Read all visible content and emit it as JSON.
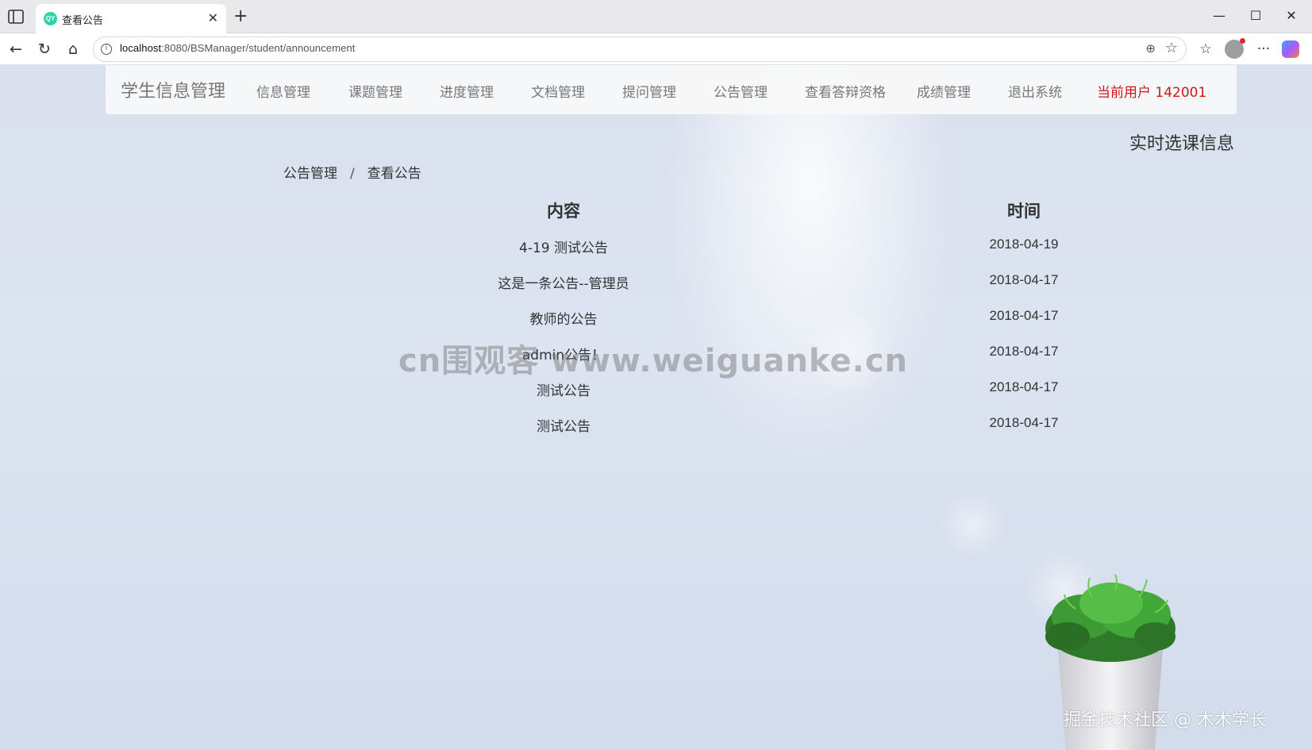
{
  "browser": {
    "tab_title": "查看公告",
    "tab_favicon_text": "QY",
    "tab_close": "✕",
    "new_tab": "+",
    "url_host": "localhost",
    "url_path": ":8080/BSManager/student/announcement",
    "window_controls": {
      "minimize": "—",
      "maximize": "☐",
      "close": "✕"
    },
    "icons": {
      "back": "←",
      "reload": "↻",
      "home": "⌂",
      "info": "i",
      "zoom": "⊕",
      "star": "☆",
      "favorites": "☆",
      "more": "···"
    }
  },
  "navbar": {
    "brand": "学生信息管理",
    "items": [
      {
        "label": "信息管理"
      },
      {
        "label": "课题管理"
      },
      {
        "label": "进度管理"
      },
      {
        "label": "文档管理"
      },
      {
        "label": "提问管理"
      },
      {
        "label": "公告管理"
      },
      {
        "label": "查看答辩资格"
      },
      {
        "label": "成绩管理"
      },
      {
        "label": "退出系统"
      }
    ],
    "current_user": "当前用户  142001",
    "current_user_color": "#d0161c"
  },
  "sidebar_link": "实时选课信息",
  "breadcrumb": {
    "parent": "公告管理",
    "separator": "/",
    "current": "查看公告"
  },
  "table": {
    "headers": {
      "content": "内容",
      "time": "时间"
    },
    "rows": [
      {
        "content": "4-19 测试公告",
        "time": "2018-04-19"
      },
      {
        "content": "这是一条公告--管理员",
        "time": "2018-04-17"
      },
      {
        "content": "教师的公告",
        "time": "2018-04-17"
      },
      {
        "content": "admin公告！",
        "time": "2018-04-17"
      },
      {
        "content": "测试公告",
        "time": "2018-04-17"
      },
      {
        "content": "测试公告",
        "time": "2018-04-17"
      }
    ]
  },
  "watermarks": {
    "center": "cn围观客 www.weiguanke.cn",
    "bottom": "掘金技术社区 @ 木木学长"
  }
}
